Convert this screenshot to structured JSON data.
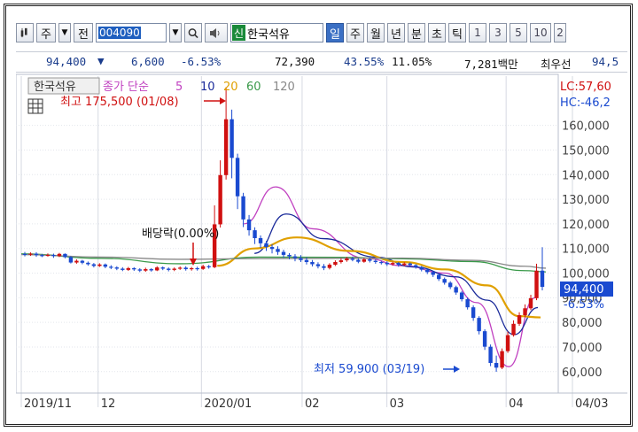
{
  "toolbar": {
    "market_type": "주",
    "mode_label": "전",
    "stock_code": "004090",
    "badge": "신",
    "stock_name": "한국석유",
    "periods": [
      "일",
      "주",
      "월",
      "년",
      "분",
      "초",
      "틱"
    ],
    "selected_period": "일",
    "intervals": [
      "1",
      "3",
      "5",
      "10",
      "2"
    ]
  },
  "quote": {
    "price": "94,400",
    "change": "6,600",
    "change_pct": "-6.53%",
    "volume": "72,390",
    "ratio1": "43.55%",
    "ratio2": "11.05%",
    "trade_value": "7,281백만",
    "ask_label": "최우선",
    "ask_value": "94,5"
  },
  "legend": {
    "stock_name": "한국석유",
    "ma_label": "종가 단순",
    "periods": [
      "5",
      "10",
      "20",
      "60",
      "120"
    ],
    "lc": "LC:57,60",
    "hc": "HC:-46,2"
  },
  "annotations": {
    "high": "최고 175,500 (01/08)",
    "low": "최저 59,900 (03/19)",
    "dividend": "배당락(0.00%)"
  },
  "current": {
    "price": "94,400",
    "pct": "-6.53%"
  },
  "chart_data": {
    "type": "candlestick",
    "y_ticks": [
      60000,
      70000,
      80000,
      90000,
      100000,
      110000,
      120000,
      130000,
      140000,
      150000,
      160000
    ],
    "y_tick_labels": [
      "60,000",
      "70,000",
      "80,000",
      "90,000",
      "100,000",
      "110,000",
      "120,000",
      "130,000",
      "140,000",
      "150,000",
      "160,000"
    ],
    "ylim": [
      52000,
      180000
    ],
    "x_labels": [
      "2019/11",
      "12",
      "2020/01",
      "02",
      "03",
      "04",
      "04/03"
    ],
    "x_label_frac": [
      0.0,
      0.145,
      0.34,
      0.53,
      0.69,
      0.915,
      1.05
    ],
    "candles": [
      [
        107800,
        107500,
        108600,
        106800
      ],
      [
        107500,
        107900,
        108400,
        107000
      ],
      [
        107900,
        107300,
        108500,
        106600
      ],
      [
        107300,
        107000,
        107800,
        106500
      ],
      [
        107000,
        107400,
        108000,
        106700
      ],
      [
        107400,
        106900,
        107900,
        106200
      ],
      [
        106900,
        107800,
        108200,
        106500
      ],
      [
        107800,
        106500,
        108000,
        106000
      ],
      [
        106500,
        104300,
        106900,
        103900
      ],
      [
        104300,
        105000,
        105600,
        103800
      ],
      [
        105000,
        104200,
        105400,
        103600
      ],
      [
        104200,
        103600,
        104700,
        103000
      ],
      [
        103600,
        102900,
        104100,
        102300
      ],
      [
        102900,
        103500,
        104000,
        102500
      ],
      [
        103500,
        102600,
        103900,
        102000
      ],
      [
        102600,
        102300,
        103200,
        101600
      ],
      [
        102300,
        101800,
        102800,
        101200
      ],
      [
        101800,
        101300,
        102400,
        100800
      ],
      [
        101300,
        102000,
        102500,
        100900
      ],
      [
        102000,
        101500,
        102400,
        100900
      ],
      [
        101500,
        101000,
        102000,
        100400
      ],
      [
        101000,
        101600,
        102200,
        100500
      ],
      [
        101600,
        101100,
        102000,
        100600
      ],
      [
        101100,
        102300,
        102800,
        100800
      ],
      [
        102300,
        101800,
        102700,
        101200
      ],
      [
        101800,
        101300,
        102300,
        100700
      ],
      [
        101300,
        101800,
        102300,
        100800
      ],
      [
        101800,
        102200,
        102700,
        101300
      ],
      [
        102200,
        101600,
        102800,
        101000
      ],
      [
        101600,
        102000,
        102500,
        101000
      ],
      [
        102000,
        101700,
        102600,
        101000
      ],
      [
        101700,
        102800,
        103400,
        101300
      ],
      [
        102800,
        102400,
        103300,
        101800
      ],
      [
        102400,
        119800,
        127500,
        102000
      ],
      [
        119800,
        139800,
        145800,
        118500
      ],
      [
        139800,
        162500,
        175500,
        138000
      ],
      [
        162500,
        146800,
        166400,
        138500
      ],
      [
        146800,
        131200,
        148500,
        126000
      ],
      [
        131200,
        121800,
        132600,
        118700
      ],
      [
        121800,
        117400,
        123600,
        115200
      ],
      [
        117400,
        114200,
        118600,
        111800
      ],
      [
        114200,
        112100,
        115300,
        110200
      ],
      [
        112100,
        110600,
        113100,
        109000
      ],
      [
        110600,
        109800,
        111700,
        108000
      ],
      [
        109800,
        108600,
        110900,
        107400
      ],
      [
        108600,
        107400,
        109500,
        106200
      ],
      [
        107400,
        106800,
        108100,
        105600
      ],
      [
        106800,
        106100,
        107700,
        104800
      ],
      [
        106100,
        105300,
        107300,
        104500
      ],
      [
        105300,
        104500,
        106400,
        103500
      ],
      [
        104500,
        103600,
        105300,
        102700
      ],
      [
        103600,
        102800,
        104400,
        101900
      ],
      [
        102800,
        102100,
        103700,
        101200
      ],
      [
        102100,
        103400,
        104000,
        101500
      ],
      [
        103400,
        104500,
        105200,
        102900
      ],
      [
        104500,
        105200,
        106000,
        103900
      ],
      [
        105200,
        105900,
        106600,
        104600
      ],
      [
        105900,
        105400,
        106700,
        104800
      ],
      [
        105400,
        104600,
        106000,
        104000
      ],
      [
        104600,
        105600,
        106100,
        104200
      ],
      [
        105600,
        105000,
        106300,
        104300
      ],
      [
        105000,
        104500,
        105600,
        103800
      ],
      [
        104500,
        104200,
        105000,
        103500
      ],
      [
        104200,
        103600,
        104800,
        102900
      ],
      [
        103600,
        104100,
        104600,
        103000
      ],
      [
        104100,
        103300,
        104500,
        102600
      ],
      [
        103300,
        103900,
        104400,
        102800
      ],
      [
        103900,
        103200,
        104300,
        102500
      ],
      [
        103200,
        102500,
        103600,
        101800
      ],
      [
        102500,
        101400,
        102900,
        100700
      ],
      [
        101400,
        100400,
        101900,
        99600
      ],
      [
        100400,
        99300,
        100900,
        98400
      ],
      [
        99300,
        97600,
        99900,
        96800
      ],
      [
        97600,
        96100,
        98200,
        95300
      ],
      [
        96100,
        94300,
        96700,
        93500
      ],
      [
        94300,
        92100,
        94900,
        91200
      ],
      [
        92100,
        89400,
        92700,
        88500
      ],
      [
        89400,
        86100,
        90100,
        85200
      ],
      [
        86100,
        81800,
        86900,
        80600
      ],
      [
        81800,
        76400,
        82500,
        75100
      ],
      [
        76400,
        70100,
        77200,
        68800
      ],
      [
        70100,
        63500,
        71000,
        62200
      ],
      [
        63500,
        61600,
        66500,
        59900
      ],
      [
        61600,
        68300,
        69400,
        61000
      ],
      [
        68300,
        74800,
        76200,
        67600
      ],
      [
        74800,
        79400,
        80800,
        74200
      ],
      [
        79400,
        82900,
        84100,
        78600
      ],
      [
        82900,
        85700,
        87300,
        82100
      ],
      [
        85700,
        89800,
        91200,
        85000
      ],
      [
        89800,
        101000,
        103800,
        89000
      ],
      [
        101000,
        94400,
        110500,
        93000
      ]
    ],
    "moving_averages": [
      {
        "name": "5",
        "color": "#c040c0",
        "x_frac": [
          0.42,
          0.48,
          0.55,
          0.65,
          0.72,
          0.8,
          0.86,
          0.92,
          0.97
        ],
        "y": [
          120000,
          135000,
          118000,
          106000,
          103000,
          100000,
          88000,
          62000,
          90000
        ]
      },
      {
        "name": "10",
        "color": "#1a2a9a",
        "x_frac": [
          0.44,
          0.5,
          0.57,
          0.67,
          0.74,
          0.82,
          0.88,
          0.93,
          0.975
        ],
        "y": [
          108000,
          124000,
          114000,
          106500,
          102500,
          98500,
          89000,
          75000,
          86000
        ]
      },
      {
        "name": "20",
        "color": "#e0a000",
        "x_frac": [
          0.37,
          0.44,
          0.52,
          0.62,
          0.72,
          0.8,
          0.88,
          0.94,
          0.98
        ],
        "y": [
          103000,
          110000,
          114500,
          109000,
          104500,
          101500,
          95000,
          82500,
          82000
        ]
      },
      {
        "name": "60",
        "color": "#3a9a4a",
        "x_frac": [
          0.0,
          0.15,
          0.3,
          0.45,
          0.6,
          0.72,
          0.85,
          0.95,
          0.99
        ],
        "y": [
          107800,
          106000,
          103800,
          106500,
          106400,
          105800,
          104700,
          101000,
          100500
        ]
      },
      {
        "name": "120",
        "color": "#888888",
        "x_frac": [
          0.0,
          0.15,
          0.3,
          0.45,
          0.6,
          0.72,
          0.85,
          0.95,
          0.99
        ],
        "y": [
          107500,
          106500,
          105600,
          105900,
          106000,
          106100,
          105200,
          102800,
          102000
        ]
      }
    ]
  }
}
